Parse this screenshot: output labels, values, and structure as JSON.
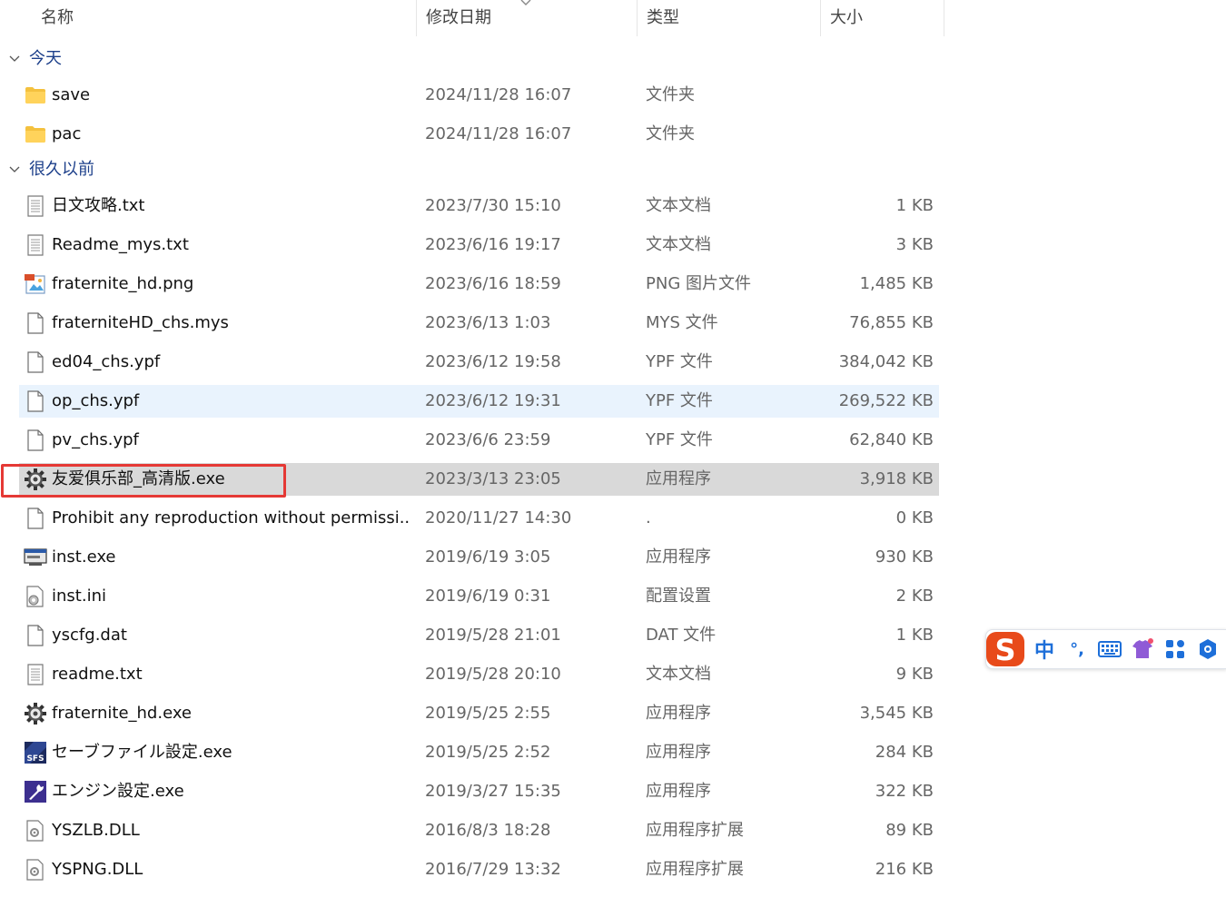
{
  "columns": {
    "name": "名称",
    "date": "修改日期",
    "type": "类型",
    "size": "大小"
  },
  "groups": {
    "today": "今天",
    "long_ago": "很久以前"
  },
  "files_today": [
    {
      "icon": "folder-icon",
      "name": "save",
      "date": "2024/11/28 16:07",
      "type": "文件夹",
      "size": ""
    },
    {
      "icon": "folder-icon",
      "name": "pac",
      "date": "2024/11/28 16:07",
      "type": "文件夹",
      "size": ""
    }
  ],
  "files_old": [
    {
      "icon": "text-file-icon",
      "name": "日文攻略.txt",
      "date": "2023/7/30 15:10",
      "type": "文本文档",
      "size": "1 KB"
    },
    {
      "icon": "text-file-icon",
      "name": "Readme_mys.txt",
      "date": "2023/6/16 19:17",
      "type": "文本文档",
      "size": "3 KB"
    },
    {
      "icon": "image-file-icon",
      "name": "fraternite_hd.png",
      "date": "2023/6/16 18:59",
      "type": "PNG 图片文件",
      "size": "1,485 KB"
    },
    {
      "icon": "blank-file-icon",
      "name": "fraterniteHD_chs.mys",
      "date": "2023/6/13 1:03",
      "type": "MYS 文件",
      "size": "76,855 KB"
    },
    {
      "icon": "blank-file-icon",
      "name": "ed04_chs.ypf",
      "date": "2023/6/12 19:58",
      "type": "YPF 文件",
      "size": "384,042 KB"
    },
    {
      "icon": "blank-file-icon",
      "name": "op_chs.ypf",
      "date": "2023/6/12 19:31",
      "type": "YPF 文件",
      "size": "269,522 KB"
    },
    {
      "icon": "blank-file-icon",
      "name": "pv_chs.ypf",
      "date": "2023/6/6 23:59",
      "type": "YPF 文件",
      "size": "62,840 KB"
    },
    {
      "icon": "gear-app-icon",
      "name": "友爱俱乐部_高清版.exe",
      "date": "2023/3/13 23:05",
      "type": "应用程序",
      "size": "3,918 KB"
    },
    {
      "icon": "blank-file-icon",
      "name": "Prohibit any reproduction without permissi...",
      "date": "2020/11/27 14:30",
      "type": ".",
      "size": "0 KB"
    },
    {
      "icon": "installer-icon",
      "name": "inst.exe",
      "date": "2019/6/19 3:05",
      "type": "应用程序",
      "size": "930 KB"
    },
    {
      "icon": "config-file-icon",
      "name": "inst.ini",
      "date": "2019/6/19 0:31",
      "type": "配置设置",
      "size": "2 KB"
    },
    {
      "icon": "blank-file-icon",
      "name": "yscfg.dat",
      "date": "2019/5/28 21:01",
      "type": "DAT 文件",
      "size": "1 KB"
    },
    {
      "icon": "text-file-icon",
      "name": "readme.txt",
      "date": "2019/5/28 20:10",
      "type": "文本文档",
      "size": "9 KB"
    },
    {
      "icon": "gear-app-icon",
      "name": "fraternite_hd.exe",
      "date": "2019/5/25 2:55",
      "type": "应用程序",
      "size": "3,545 KB"
    },
    {
      "icon": "sfs-app-icon",
      "name": "セーブファイル設定.exe",
      "date": "2019/5/25 2:52",
      "type": "应用程序",
      "size": "284 KB"
    },
    {
      "icon": "wrench-app-icon",
      "name": "エンジン設定.exe",
      "date": "2019/3/27 15:35",
      "type": "应用程序",
      "size": "322 KB"
    },
    {
      "icon": "dll-file-icon",
      "name": "YSZLB.DLL",
      "date": "2016/8/3 18:28",
      "type": "应用程序扩展",
      "size": "89 KB"
    },
    {
      "icon": "dll-file-icon",
      "name": "YSPNG.DLL",
      "date": "2016/7/29 13:32",
      "type": "应用程序扩展",
      "size": "216 KB"
    }
  ],
  "ime_toolbar": {
    "lang": "中",
    "punct": "°,"
  },
  "colors": {
    "hover_row": "#e9f3fd",
    "selected_row": "#d9d9d9",
    "annotation": "#e53935",
    "group_text": "#1c3f8a",
    "ime_blue": "#1e6fd9",
    "ime_logo": "#e84a1a"
  }
}
